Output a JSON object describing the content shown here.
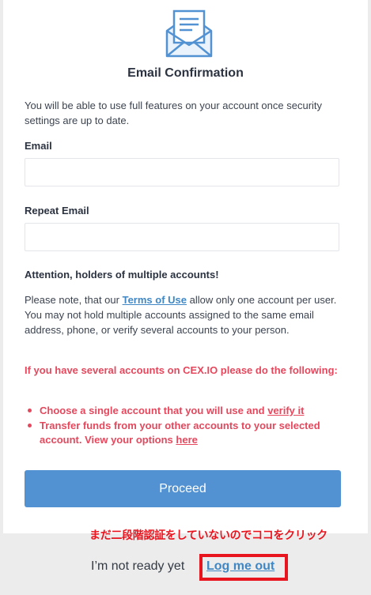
{
  "header": {
    "icon": "envelope-with-letter-icon",
    "title": "Email Confirmation"
  },
  "intro": "You will be able to use full features on your account once security settings are up to date.",
  "form": {
    "email_label": "Email",
    "email_value": "",
    "repeat_label": "Repeat Email",
    "repeat_value": ""
  },
  "attention": {
    "heading": "Attention, holders of multiple accounts!",
    "note_before": "Please note, that our ",
    "terms_link": "Terms of Use",
    "note_after": " allow only one account per user. You may not hold multiple accounts assigned to the same email address, phone, or verify several accounts to your person."
  },
  "warning": {
    "heading": "If you have several accounts on CEX.IO please do the following:",
    "item1_text": "Choose a single account that you will use and ",
    "item1_link": "verify it",
    "item2_text": "Transfer funds from your other accounts to your selected account. View your options ",
    "item2_link": "here"
  },
  "proceed_label": "Proceed",
  "annotation": "まだ二段階認証をしていないのでココをクリック",
  "footer": {
    "text": "I’m not ready yet",
    "logout_label": "Log me out"
  },
  "colors": {
    "accent": "#5292d2",
    "link": "#3f88c5",
    "warning": "#e5485d",
    "annotation": "#e8141e"
  }
}
